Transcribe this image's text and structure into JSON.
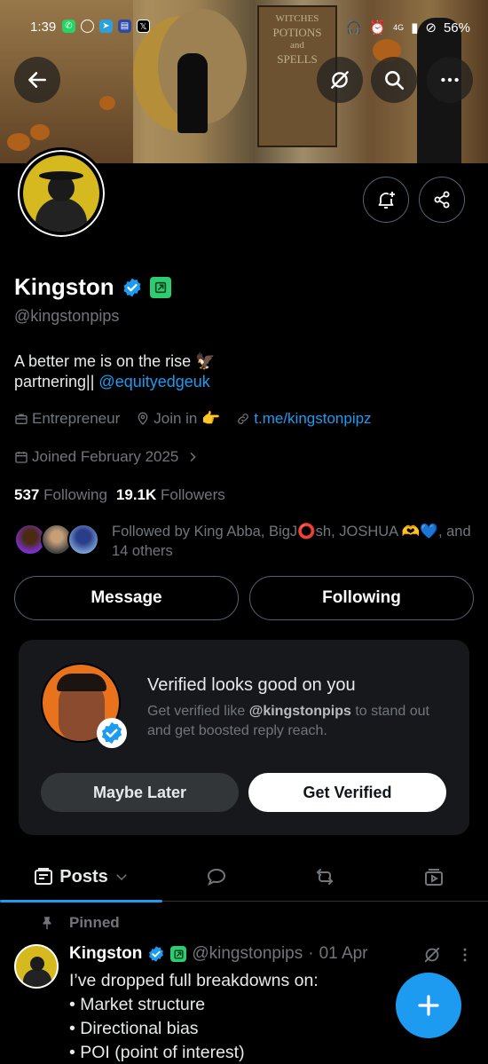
{
  "status_bar": {
    "time": "1:39",
    "network": "4G",
    "battery": "56%"
  },
  "banner": {
    "sign_text": [
      "WITCHES",
      "POTIONS",
      "and",
      "SPELLS"
    ]
  },
  "profile": {
    "name": "Kingston",
    "handle": "@kingstonpips",
    "bio_line1": "A better me is on the rise 🦅",
    "bio_line2_prefix": "partnering||",
    "bio_link": "@equityedgeuk",
    "category": "Entrepreneur",
    "location": "Join in 👉",
    "website": "t.me/kingstonpipz",
    "joined": "Joined February 2025",
    "following_count": "537",
    "following_label": "Following",
    "followers_count": "19.1K",
    "followers_label": "Followers",
    "followed_by": "Followed by King Abba, BigJ⭕sh, JOSHUA 🫶💙, and 14 others"
  },
  "actions": {
    "message": "Message",
    "following": "Following"
  },
  "verify_card": {
    "title": "Verified looks good on you",
    "desc_prefix": "Get verified like ",
    "desc_handle": "@kingstonpips",
    "desc_suffix": " to stand out and get boosted reply reach.",
    "maybe_later": "Maybe Later",
    "get_verified": "Get Verified"
  },
  "tabs": {
    "posts": "Posts"
  },
  "pinned_post": {
    "pinned_label": "Pinned",
    "name": "Kingston",
    "handle": "@kingstonpips",
    "separator": "·",
    "date": "01 Apr",
    "lines": [
      "I’ve dropped full breakdowns on:",
      "• Market structure",
      "• Directional bias",
      "• POI (point of interest)"
    ]
  },
  "icons": {
    "back": "arrow-left-icon",
    "grok": "grok-icon",
    "search": "search-icon",
    "more": "more-horizontal-icon",
    "notify": "bell-plus-icon",
    "share": "share-icon",
    "verified": "verified-check-icon",
    "affiliate": "affiliate-badge-icon",
    "compose": "plus-icon"
  },
  "colors": {
    "accent": "#1d9bf0",
    "affiliate": "#2ecc71",
    "card_bg": "#16181c",
    "muted": "#71767b"
  }
}
